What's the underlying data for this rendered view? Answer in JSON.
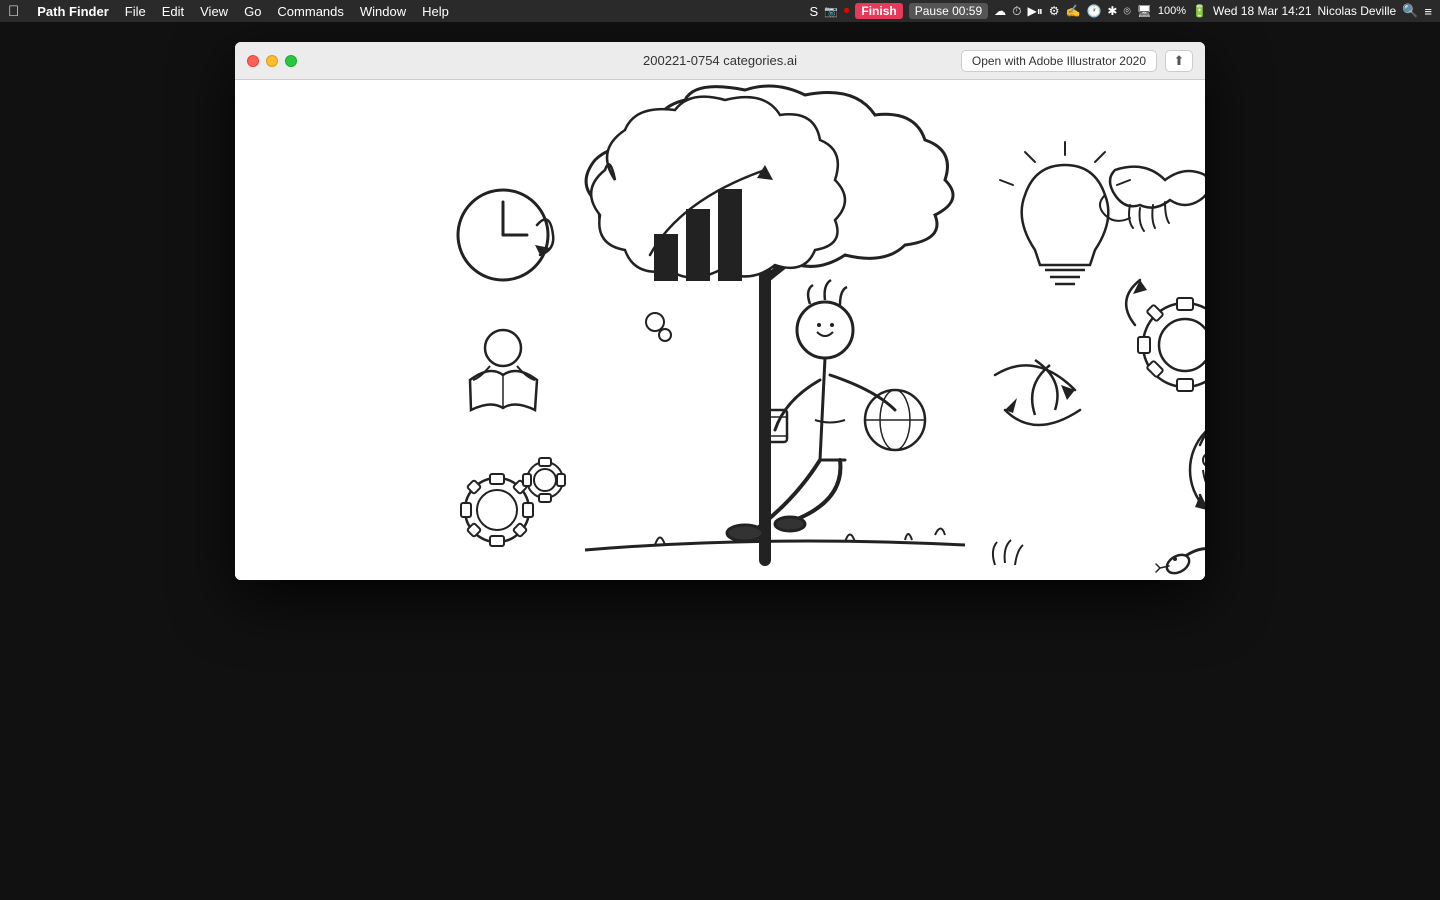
{
  "menubar": {
    "apple_icon": "⌘",
    "app_name": "Path Finder",
    "menus": [
      "File",
      "Edit",
      "View",
      "Go",
      "Commands",
      "Window",
      "Help"
    ],
    "finish_label": "Finish",
    "pause_label": "Pause 00:59",
    "battery": "100%",
    "date_time": "Wed 18 Mar  14:21",
    "user": "Nicolas Deville"
  },
  "window": {
    "title": "200221-0754 categories.ai",
    "open_with_label": "Open with Adobe Illustrator 2020",
    "share_icon": "↑",
    "close_icon": "✕",
    "back_icon": "↺"
  }
}
